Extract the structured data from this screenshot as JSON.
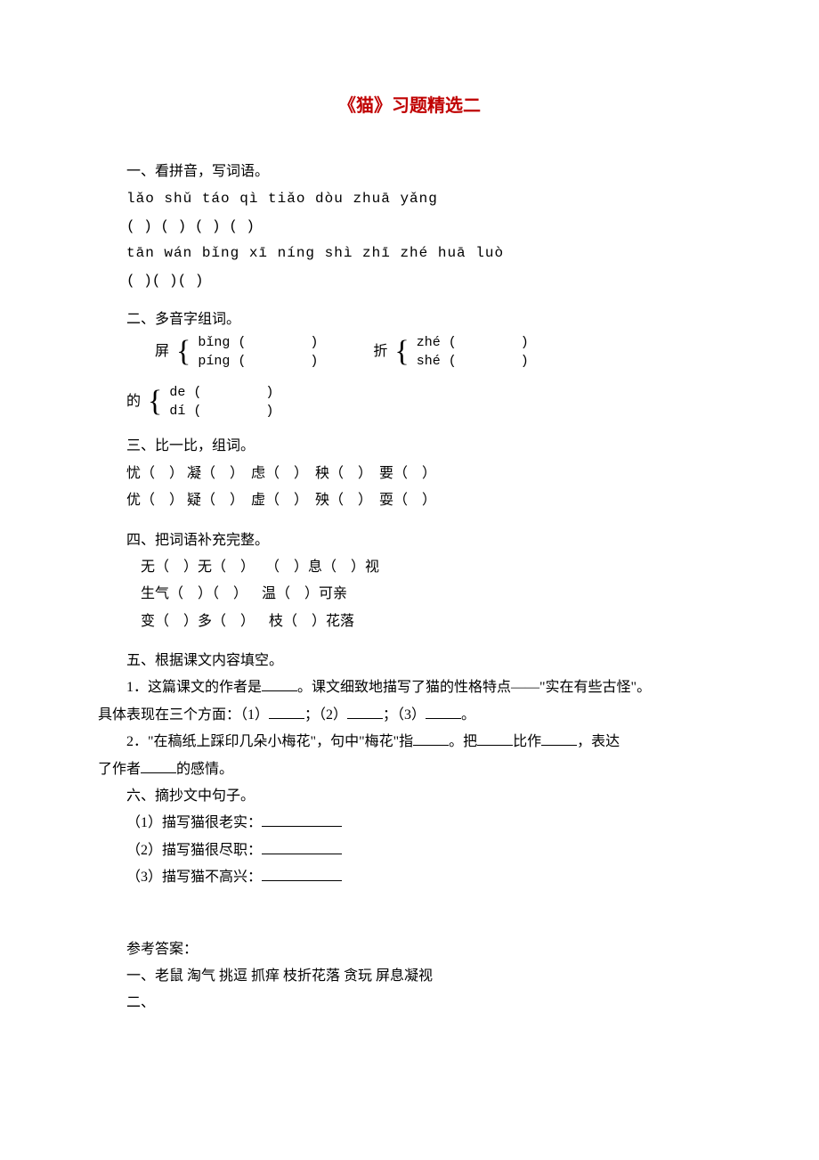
{
  "title": "《猫》习题精选二",
  "s1": {
    "head": "一、看拼音，写词语。",
    "line1": "lǎo shǔ   táo qì   tiǎo dòu   zhuā yǎng",
    "line2": "(      ) (      ) (        ) (          )",
    "line3": "tān wán  bǐng xī níng shì  zhī zhé huā luò",
    "line4": "(      )(                 )(              )"
  },
  "s2": {
    "head": "二、多音字组词。",
    "ping": {
      "char": "屏",
      "r1": "bǐng (        )",
      "r2": "píng (        )"
    },
    "zhe": {
      "char": "折",
      "r1": "zhé (        )",
      "r2": "shé (        )"
    },
    "de": {
      "char": "的",
      "r1": "de (        )",
      "r2": "dí (        )"
    }
  },
  "s3": {
    "head": "三、比一比，组词。",
    "row1": "忧（    ） 凝（    ）  虑（    ）  秧（    ）  要（    ）",
    "row2": "优（    ） 疑（    ）  虚（    ）  殃（    ）  耍（    ）"
  },
  "s4": {
    "head": "四、把词语补充完整。",
    "l1": "无（    ）无（    ）   （    ）息（    ）视",
    "l2": "生气（    ）（    ）    温（    ）可亲",
    "l3": "变（    ）多（    ）    枝（    ）花落"
  },
  "s5": {
    "head": "五、根据课文内容填空。",
    "p1a": "1．这篇课文的作者是",
    "p1b": "。课文细致地描写了猫的性格特点——\"实在有些古怪\"。",
    "p1c": "具体表现在三个方面：（1）",
    "p1d": "；（2）",
    "p1e": "；（3）",
    "p1f": "。",
    "p2a": "2．\"在稿纸上踩印几朵小梅花\"，句中\"梅花\"指",
    "p2b": "。把",
    "p2c": "比作",
    "p2d": "，表达",
    "p2e": "了作者",
    "p2f": "的感情。"
  },
  "s6": {
    "head": "六、摘抄文中句子。",
    "l1": "（1）描写猫很老实：",
    "l2": "（2）描写猫很尽职：",
    "l3": "（3）描写猫不高兴："
  },
  "ans": {
    "head": "参考答案：",
    "l1": "一、老鼠    淘气    挑逗   抓痒    枝折花落   贪玩    屏息凝视",
    "l2": "二、"
  }
}
